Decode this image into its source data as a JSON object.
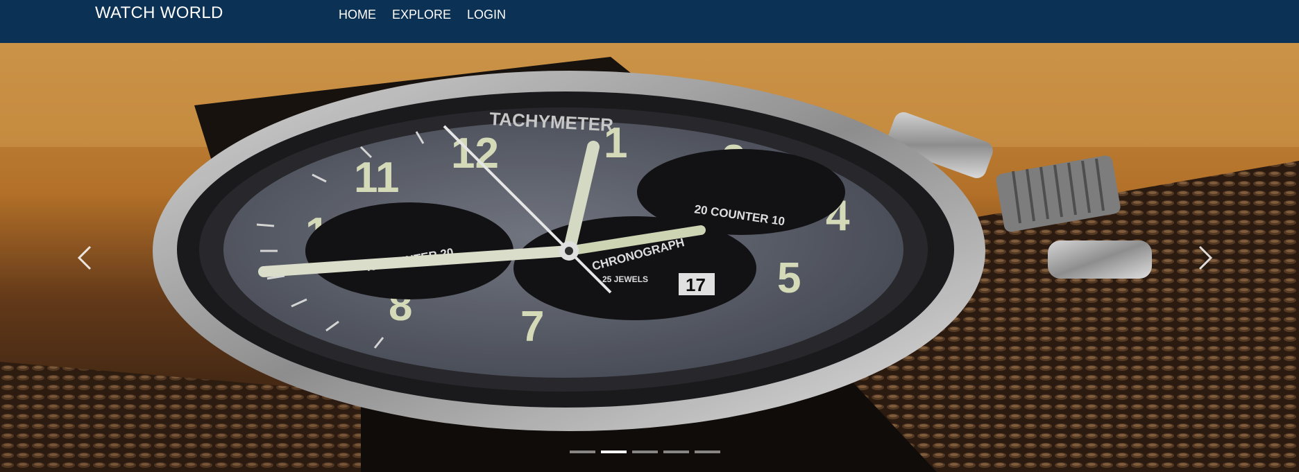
{
  "navbar": {
    "brand": "WATCH WORLD",
    "links": [
      {
        "label": "HOME"
      },
      {
        "label": "EXPLORE"
      },
      {
        "label": "LOGIN"
      }
    ]
  },
  "carousel": {
    "slide_image": "wristwatch-chronograph-photo",
    "dial_text": {
      "bezel": "TACHYMETER",
      "chronograph": "CHRONOGRAPH",
      "counter": "COUNTER",
      "jewels": "25 JEWELS",
      "date": "17"
    },
    "prev_icon": "chevron-left-icon",
    "next_icon": "chevron-right-icon",
    "slide_count": 5,
    "active_index": 1
  }
}
